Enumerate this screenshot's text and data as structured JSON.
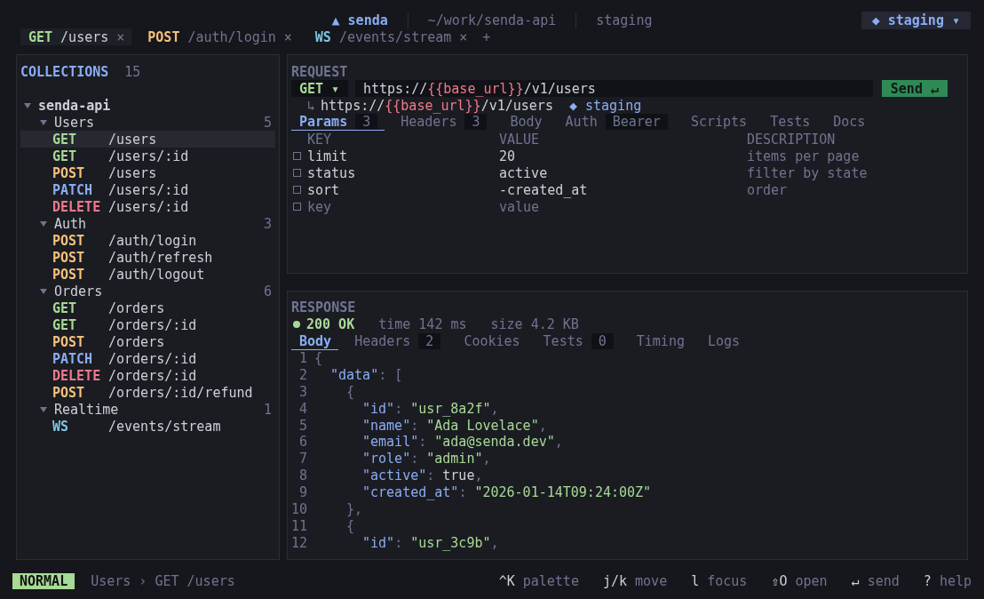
{
  "topbar": {
    "app": "▲ senda",
    "path": "~/work/senda-api",
    "env_label": "staging",
    "env_selector": "◆ staging ▾"
  },
  "open_tabs": [
    {
      "method": "GET",
      "color": "#a6da95",
      "path": "/users",
      "close": "×",
      "selected": true
    },
    {
      "method": "POST",
      "color": "#f5c07a",
      "path": "/auth/login",
      "close": "×",
      "selected": false
    },
    {
      "method": "WS",
      "color": "#7dc4e4",
      "path": "/events/stream",
      "close": "×",
      "selected": false
    }
  ],
  "new_tab": "+",
  "collections": {
    "title": "COLLECTIONS",
    "count": "15",
    "root": {
      "name": "senda-api",
      "expanded": true,
      "children": [
        {
          "name": "Users",
          "count": "5",
          "expanded": true,
          "children": [
            {
              "method": "GET",
              "color": "#a6da95",
              "path": "/users",
              "selected": true
            },
            {
              "method": "GET",
              "color": "#a6da95",
              "path": "/users/:id",
              "selected": false
            },
            {
              "method": "POST",
              "color": "#f5c07a",
              "path": "/users",
              "selected": false
            },
            {
              "method": "PATCH",
              "color": "#8aadf4",
              "path": "/users/:id",
              "selected": false
            },
            {
              "method": "DELETE",
              "color": "#f0798b",
              "path": "/users/:id",
              "selected": false
            }
          ]
        },
        {
          "name": "Auth",
          "count": "3",
          "expanded": true,
          "children": [
            {
              "method": "POST",
              "color": "#f5c07a",
              "path": "/auth/login",
              "selected": false
            },
            {
              "method": "POST",
              "color": "#f5c07a",
              "path": "/auth/refresh",
              "selected": false
            },
            {
              "method": "POST",
              "color": "#f5c07a",
              "path": "/auth/logout",
              "selected": false
            }
          ]
        },
        {
          "name": "Orders",
          "count": "6",
          "expanded": true,
          "children": [
            {
              "method": "GET",
              "color": "#a6da95",
              "path": "/orders",
              "selected": false
            },
            {
              "method": "GET",
              "color": "#a6da95",
              "path": "/orders/:id",
              "selected": false
            },
            {
              "method": "POST",
              "color": "#f5c07a",
              "path": "/orders",
              "selected": false
            },
            {
              "method": "PATCH",
              "color": "#8aadf4",
              "path": "/orders/:id",
              "selected": false
            },
            {
              "method": "DELETE",
              "color": "#f0798b",
              "path": "/orders/:id",
              "selected": false
            },
            {
              "method": "POST",
              "color": "#f5c07a",
              "path": "/orders/:id/refund",
              "selected": false
            }
          ]
        },
        {
          "name": "Realtime",
          "count": "1",
          "expanded": true,
          "children": [
            {
              "method": "WS",
              "color": "#7dc4e4",
              "path": "/events/stream",
              "selected": false
            }
          ]
        }
      ]
    }
  },
  "request": {
    "title": "REQUEST",
    "method": "GET ▾",
    "url_parts": [
      {
        "kind": "plain",
        "text": "https://"
      },
      {
        "kind": "var",
        "text": "{{base_url}}"
      },
      {
        "kind": "plain",
        "text": "/v1/users"
      }
    ],
    "send": "Send ↵",
    "resolved_arrow": "↳",
    "resolved_parts": [
      {
        "kind": "plain",
        "text": "https://"
      },
      {
        "kind": "var",
        "text": "{{base_url}}"
      },
      {
        "kind": "plain",
        "text": "/v1/users"
      }
    ],
    "resolved_env": "◆ staging",
    "tabs": [
      {
        "label": "Params",
        "badge": "3",
        "selected": true
      },
      {
        "label": "Headers",
        "badge": "3",
        "selected": false
      },
      {
        "label": "Body",
        "selected": false
      },
      {
        "label": "Auth",
        "badge": "Bearer",
        "selected": false
      },
      {
        "label": "Scripts",
        "selected": false
      },
      {
        "label": "Tests",
        "selected": false
      },
      {
        "label": "Docs",
        "selected": false
      }
    ],
    "columns": [
      "KEY",
      "VALUE",
      "DESCRIPTION"
    ],
    "params": [
      {
        "kind": "param",
        "key": "limit",
        "value": "20",
        "description": "items per page",
        "checked": false
      },
      {
        "kind": "param",
        "key": "status",
        "value": "active",
        "description": "filter by state",
        "checked": false
      },
      {
        "kind": "param",
        "key": "sort",
        "value": "-created_at",
        "description": "order",
        "checked": false
      },
      {
        "kind": "placeholder",
        "key": "key",
        "value": "value",
        "checked": false
      }
    ]
  },
  "response": {
    "title": "RESPONSE",
    "status": "200 OK",
    "time": "time 142 ms",
    "size": "size 4.2 KB",
    "tabs": [
      {
        "label": "Body",
        "selected": true
      },
      {
        "label": "Headers",
        "badge": "2",
        "selected": false
      },
      {
        "label": "Cookies",
        "selected": false
      },
      {
        "label": "Tests",
        "badge": "0",
        "selected": false
      },
      {
        "label": "Timing",
        "selected": false
      },
      {
        "label": "Logs",
        "selected": false
      }
    ],
    "lines": [
      {
        "n": "1",
        "tokens": [
          {
            "kind": "punct",
            "text": "{"
          }
        ],
        "children": [
          {
            "n": "2",
            "tokens": [
              {
                "kind": "key",
                "text": "\"data\""
              },
              {
                "kind": "punct",
                "text": ": ["
              }
            ],
            "children": [
              {
                "n": "3",
                "tokens": [
                  {
                    "kind": "punct",
                    "text": "{"
                  }
                ],
                "children": [
                  {
                    "n": "4",
                    "tokens": [
                      {
                        "kind": "key",
                        "text": "\"id\""
                      },
                      {
                        "kind": "punct",
                        "text": ": "
                      },
                      {
                        "kind": "string",
                        "text": "\"usr_8a2f\""
                      },
                      {
                        "kind": "punct",
                        "text": ","
                      }
                    ]
                  },
                  {
                    "n": "5",
                    "tokens": [
                      {
                        "kind": "key",
                        "text": "\"name\""
                      },
                      {
                        "kind": "punct",
                        "text": ": "
                      },
                      {
                        "kind": "string",
                        "text": "\"Ada Lovelace\""
                      },
                      {
                        "kind": "punct",
                        "text": ","
                      }
                    ]
                  },
                  {
                    "n": "6",
                    "tokens": [
                      {
                        "kind": "key",
                        "text": "\"email\""
                      },
                      {
                        "kind": "punct",
                        "text": ": "
                      },
                      {
                        "kind": "string",
                        "text": "\"ada@senda.dev\""
                      },
                      {
                        "kind": "punct",
                        "text": ","
                      }
                    ]
                  },
                  {
                    "n": "7",
                    "tokens": [
                      {
                        "kind": "key",
                        "text": "\"role\""
                      },
                      {
                        "kind": "punct",
                        "text": ": "
                      },
                      {
                        "kind": "string",
                        "text": "\"admin\""
                      },
                      {
                        "kind": "punct",
                        "text": ","
                      }
                    ]
                  },
                  {
                    "n": "8",
                    "tokens": [
                      {
                        "kind": "key",
                        "text": "\"active\""
                      },
                      {
                        "kind": "punct",
                        "text": ": "
                      },
                      {
                        "kind": "bool",
                        "text": "true"
                      },
                      {
                        "kind": "punct",
                        "text": ","
                      }
                    ]
                  },
                  {
                    "n": "9",
                    "tokens": [
                      {
                        "kind": "key",
                        "text": "\"created_at\""
                      },
                      {
                        "kind": "punct",
                        "text": ": "
                      },
                      {
                        "kind": "string",
                        "text": "\"2026-01-14T09:24:00Z\""
                      }
                    ]
                  }
                ]
              },
              {
                "n": "10",
                "tokens": [
                  {
                    "kind": "punct",
                    "text": "},"
                  }
                ]
              },
              {
                "n": "11",
                "tokens": [
                  {
                    "kind": "punct",
                    "text": "{"
                  }
                ],
                "children": [
                  {
                    "n": "12",
                    "tokens": [
                      {
                        "kind": "key",
                        "text": "\"id\""
                      },
                      {
                        "kind": "punct",
                        "text": ": "
                      },
                      {
                        "kind": "string",
                        "text": "\"usr_3c9b\""
                      },
                      {
                        "kind": "punct",
                        "text": ","
                      }
                    ]
                  }
                ]
              }
            ]
          }
        ]
      }
    ]
  },
  "status_bar": {
    "mode": "NORMAL",
    "breadcrumb": "Users › GET /users",
    "hints": [
      {
        "key": "^K",
        "label": "palette"
      },
      {
        "key": "j/k",
        "label": "move"
      },
      {
        "key": "l",
        "label": "focus"
      },
      {
        "key": "⇧O",
        "label": "open"
      },
      {
        "key": "↵",
        "label": "send"
      },
      {
        "key": "?",
        "label": "help"
      }
    ]
  }
}
